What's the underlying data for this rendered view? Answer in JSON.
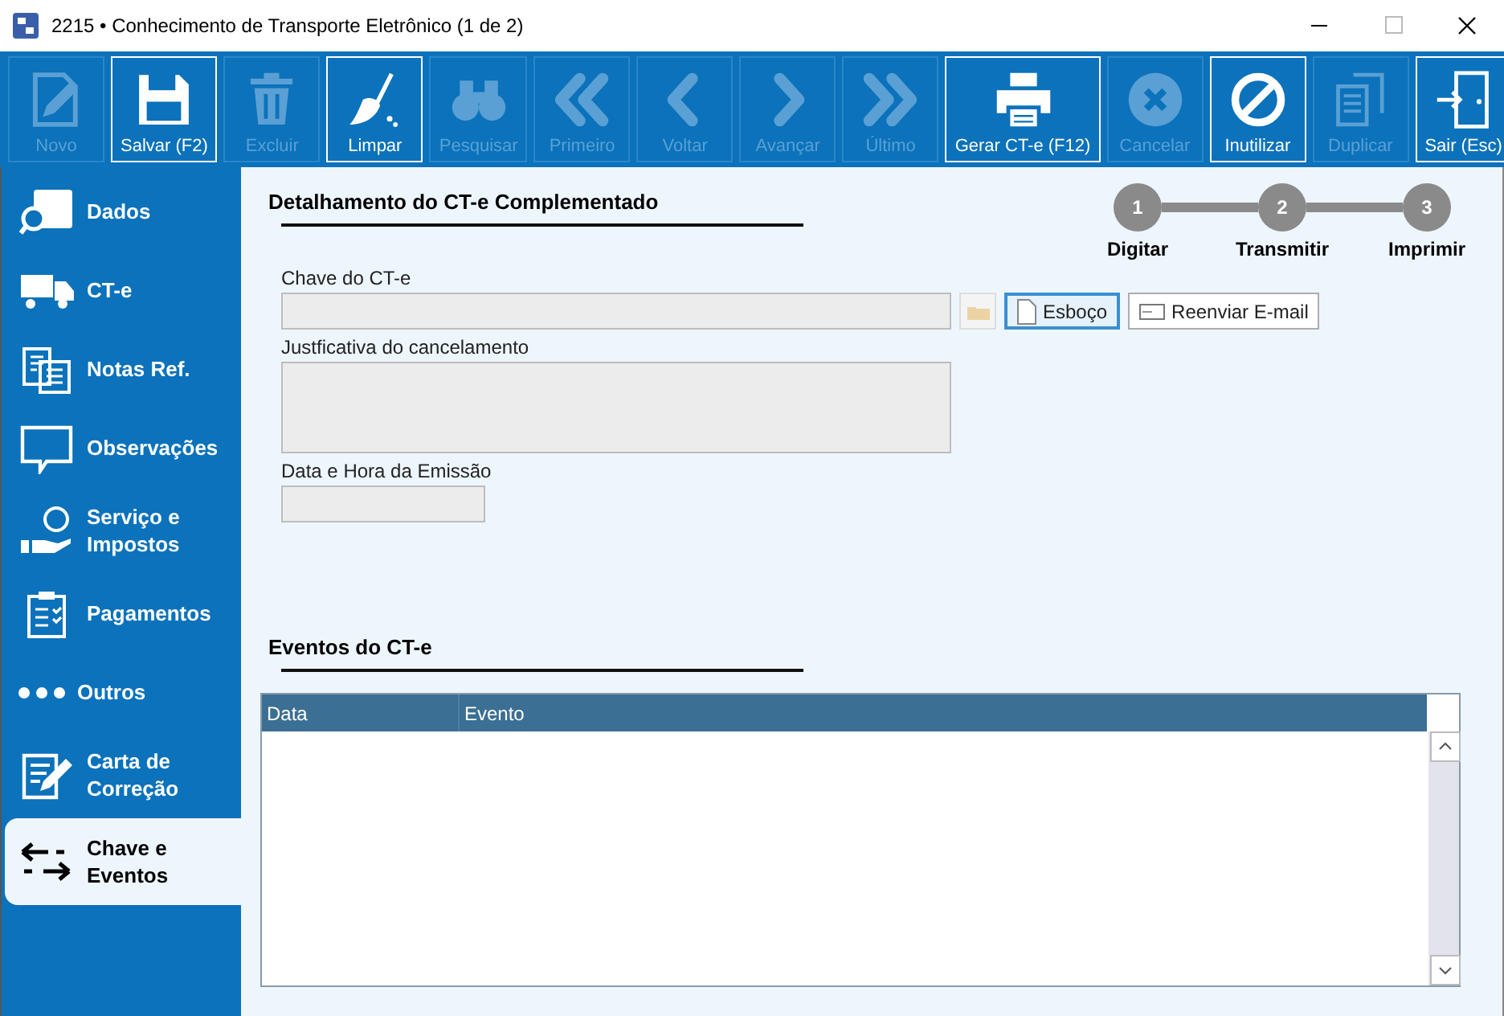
{
  "window": {
    "title": "2215 • Conhecimento de Transporte Eletrônico (1 de 2)"
  },
  "toolbar": [
    {
      "label": "Novo",
      "disabled": true
    },
    {
      "label": "Salvar (F2)",
      "disabled": false
    },
    {
      "label": "Excluir",
      "disabled": true
    },
    {
      "label": "Limpar",
      "disabled": false
    },
    {
      "label": "Pesquisar",
      "disabled": true
    },
    {
      "label": "Primeiro",
      "disabled": true
    },
    {
      "label": "Voltar",
      "disabled": true
    },
    {
      "label": "Avançar",
      "disabled": true
    },
    {
      "label": "Último",
      "disabled": true
    },
    {
      "label": "Gerar CT-e (F12)",
      "disabled": false
    },
    {
      "label": "Cancelar",
      "disabled": true
    },
    {
      "label": "Inutilizar",
      "disabled": false
    },
    {
      "label": "Duplicar",
      "disabled": true
    },
    {
      "label": "Sair (Esc)",
      "disabled": false
    }
  ],
  "sidebar": {
    "items": [
      {
        "label": "Dados",
        "selected": false
      },
      {
        "label": "CT-e",
        "selected": false
      },
      {
        "label": "Notas Ref.",
        "selected": false
      },
      {
        "label": "Observações",
        "selected": false
      },
      {
        "label": "Serviço e\nImpostos",
        "selected": false
      },
      {
        "label": "Pagamentos",
        "selected": false
      },
      {
        "label": "Outros",
        "selected": false
      },
      {
        "label": "Carta de\nCorreção",
        "selected": false
      },
      {
        "label": "Chave e\nEventos",
        "selected": true
      }
    ]
  },
  "detail": {
    "heading": "Detalhamento do CT-e Complementado",
    "steps": [
      {
        "number": "1",
        "label": "Digitar"
      },
      {
        "number": "2",
        "label": "Transmitir"
      },
      {
        "number": "3",
        "label": "Imprimir"
      }
    ],
    "fields": [
      {
        "label": "Chave do CT-e",
        "kind": "key"
      },
      {
        "label": "Justficativa do cancelamento",
        "kind": "multiline"
      },
      {
        "label": "Data e Hora da Emissão",
        "kind": "short"
      }
    ],
    "buttons": [
      {
        "kind": "folder",
        "disabled": true
      },
      {
        "kind": "draft",
        "label": "Esboço",
        "focused": true,
        "disabled": false
      },
      {
        "kind": "email",
        "label": "Reenviar E-mail",
        "focused": false,
        "disabled": false
      }
    ]
  },
  "events": {
    "heading": "Eventos do CT-e",
    "columns": [
      "Data",
      "Evento"
    ]
  }
}
